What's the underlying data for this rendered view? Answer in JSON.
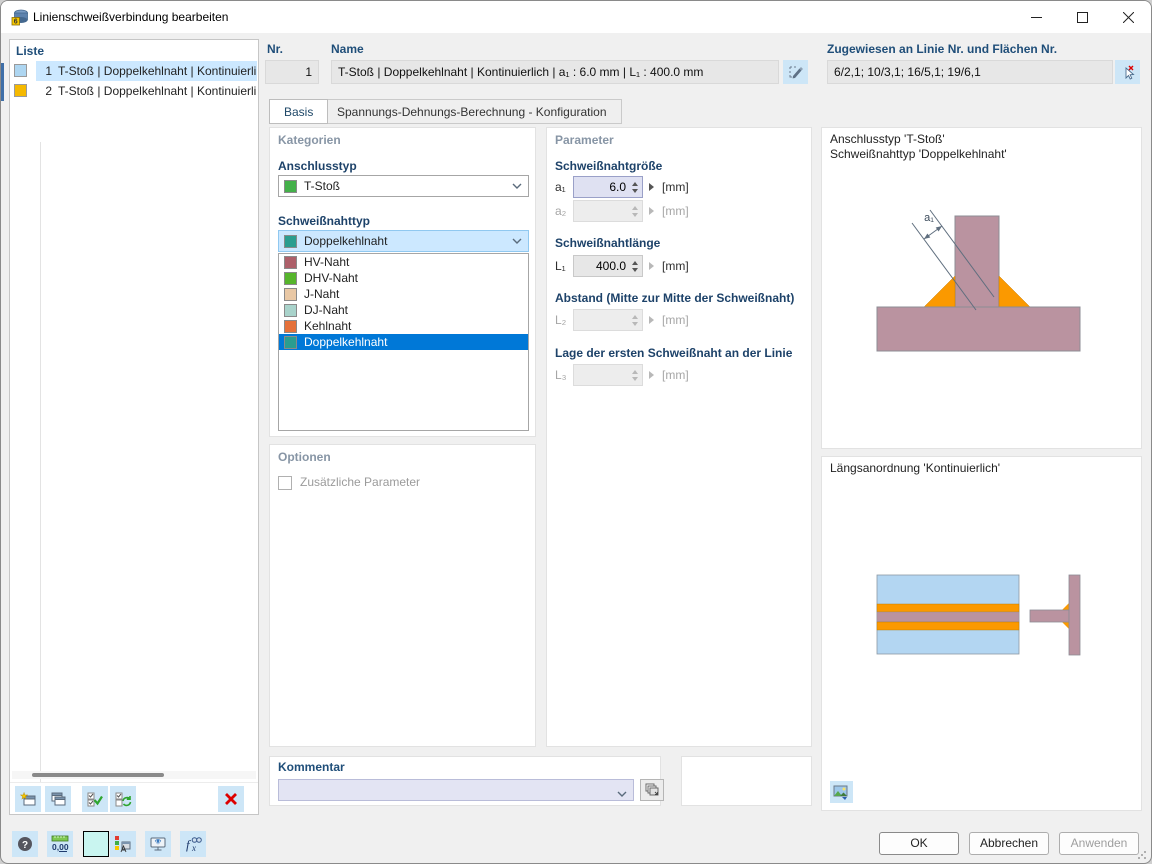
{
  "window": {
    "title": "Linienschweißverbindung bearbeiten"
  },
  "liste": {
    "header": "Liste",
    "items": [
      {
        "nr": "1",
        "label": "T-Stoß | Doppelkehlnaht | Kontinuierlic",
        "color": "#aed6f1",
        "selected": true
      },
      {
        "nr": "2",
        "label": "T-Stoß | Doppelkehlnaht | Kontinuierlic",
        "color": "#f5b900",
        "selected": false
      }
    ]
  },
  "header_fields": {
    "nr_label": "Nr.",
    "nr_value": "1",
    "name_label": "Name",
    "name_value": "T-Stoß | Doppelkehlnaht | Kontinuierlich | a₁ : 6.0 mm | L₁ : 400.0 mm",
    "assigned_label": "Zugewiesen an Linie Nr. und Flächen Nr.",
    "assigned_value": "6/2,1; 10/3,1; 16/5,1; 19/6,1"
  },
  "tabs": [
    {
      "label": "Basis"
    },
    {
      "label": "Spannungs-Dehnungs-Berechnung - Konfiguration"
    }
  ],
  "kategorien": {
    "header": "Kategorien",
    "anschlusstyp_label": "Anschlusstyp",
    "anschlusstyp_value": "T-Stoß",
    "anschlusstyp_color": "#44b04a",
    "schweissnahttyp_label": "Schweißnahttyp",
    "schweissnahttyp_value": "Doppelkehlnaht",
    "schweissnahttyp_color": "#2a9d8f",
    "weld_types": [
      {
        "label": "HV-Naht",
        "color": "#ad5f69"
      },
      {
        "label": "DHV-Naht",
        "color": "#56b52c"
      },
      {
        "label": "J-Naht",
        "color": "#e9c8a5"
      },
      {
        "label": "DJ-Naht",
        "color": "#a9d3cb"
      },
      {
        "label": "Kehlnaht",
        "color": "#e5713a"
      },
      {
        "label": "Doppelkehlnaht",
        "color": "#2a9d8f"
      }
    ]
  },
  "optionen": {
    "header": "Optionen",
    "checkbox_label": "Zusätzliche Parameter"
  },
  "parameter": {
    "header": "Parameter",
    "size_label": "Schweißnahtgröße",
    "a1_label": "a₁",
    "a1_value": "6.0",
    "a1_unit": "[mm]",
    "a2_label": "a₂",
    "a2_value": "",
    "a2_unit": "[mm]",
    "length_label": "Schweißnahtlänge",
    "l1_label": "L₁",
    "l1_value": "400.0",
    "l1_unit": "[mm]",
    "spacing_label": "Abstand (Mitte zur Mitte der Schweißnaht)",
    "l2_label": "L₂",
    "l2_value": "",
    "l2_unit": "[mm]",
    "position_label": "Lage der ersten Schweißnaht an der Linie",
    "l3_label": "L₃",
    "l3_value": "",
    "l3_unit": "[mm]"
  },
  "kommentar": {
    "header": "Kommentar",
    "value": ""
  },
  "preview": {
    "joint_title_line1": "Anschlusstyp 'T-Stoß'",
    "joint_title_line2": "Schweißnahttyp 'Doppelkehlnaht'",
    "dim_label": "a₁",
    "arrangement_title": "Längsanordnung 'Kontinuierlich'",
    "plate_color": "#ba93a0",
    "weld_color": "#fb9900",
    "face_color": "#b3d6f2"
  },
  "footer": {
    "ok": "OK",
    "cancel": "Abbrechen",
    "apply": "Anwenden",
    "units_text": "0,00"
  },
  "colors": {
    "selection_blue": "#0078d7",
    "combo_highlight": "#cce8ff",
    "toolbar_button_bg": "#cde6f7",
    "header_navy": "#1f4e79",
    "section_gray": "#8795a5"
  }
}
